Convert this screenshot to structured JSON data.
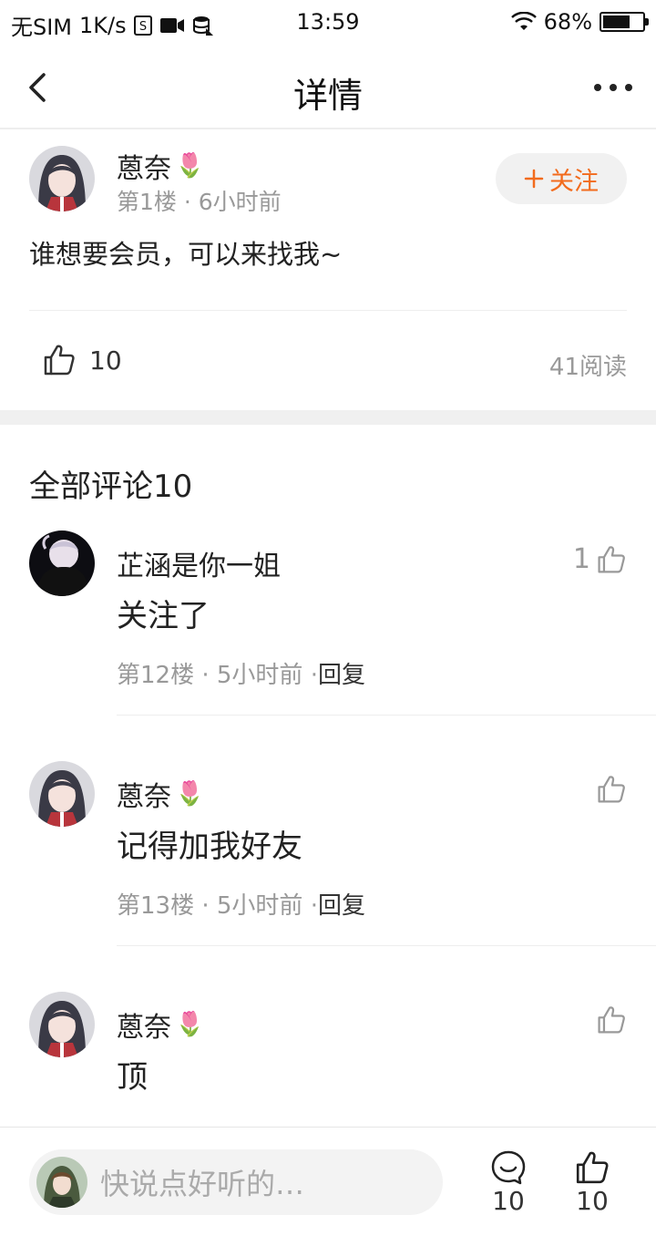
{
  "status_bar": {
    "carrier": "无SIM",
    "speed": "1K/s",
    "time": "13:59",
    "battery": "68%",
    "battery_level": 0.68
  },
  "nav": {
    "title": "详情"
  },
  "post": {
    "username": "蒽奈",
    "username_emoji": "🌷",
    "meta": "第1楼 · 6小时前",
    "follow_label": "关注",
    "body": "谁想要会员，可以来找我~",
    "likes": "10",
    "reads": "41阅读"
  },
  "comments_header": "全部评论10",
  "comments": [
    {
      "username": "芷涵是你一姐",
      "text": "关注了",
      "floor": "第12楼",
      "time": "5小时前",
      "reply": "回复",
      "likes": "1"
    },
    {
      "username": "蒽奈",
      "username_emoji": "🌷",
      "text": "记得加我好友",
      "floor": "第13楼",
      "time": "5小时前",
      "reply": "回复",
      "likes": ""
    },
    {
      "username": "蒽奈",
      "username_emoji": "🌷",
      "text": "顶",
      "floor": "",
      "time": "",
      "reply": "",
      "likes": ""
    }
  ],
  "bottom_bar": {
    "placeholder": "快说点好听的…",
    "comment_count": "10",
    "like_count": "10"
  },
  "colors": {
    "accent": "#f26b1d",
    "muted": "#999999",
    "divider": "#eeeeee"
  }
}
